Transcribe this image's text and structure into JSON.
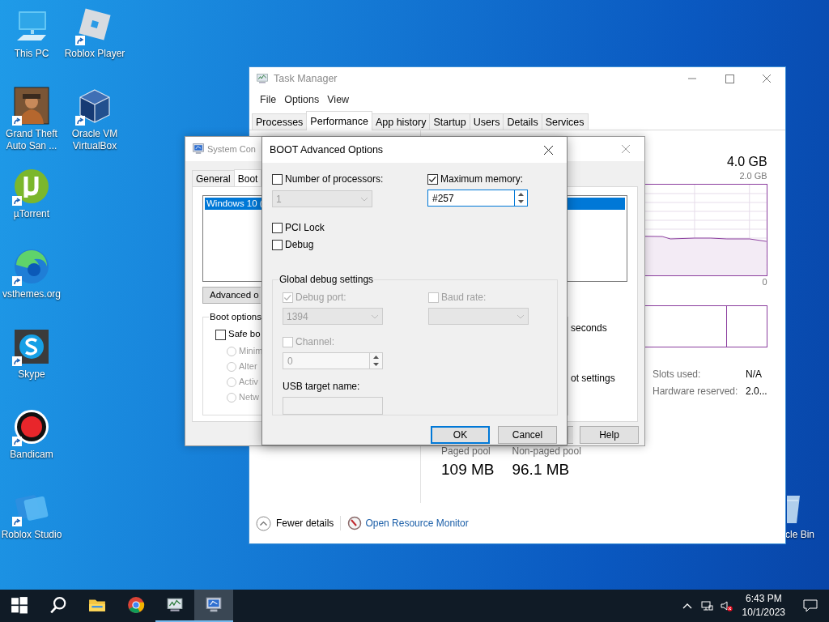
{
  "desktop": {
    "columns": [
      [
        {
          "label": "This PC",
          "kind": "pc",
          "shortcut": false
        },
        {
          "label": "Grand Theft Auto San ...",
          "kind": "game",
          "shortcut": true
        },
        {
          "label": "µTorrent",
          "kind": "torrent",
          "shortcut": true
        },
        {
          "label": "vsthemes.org",
          "kind": "edge",
          "shortcut": true
        },
        {
          "label": "Skype",
          "kind": "skype",
          "shortcut": true
        },
        {
          "label": "Bandicam",
          "kind": "bandicam",
          "shortcut": true
        },
        {
          "label": "Roblox Studio",
          "kind": "studio",
          "shortcut": true
        }
      ],
      [
        {
          "label": "Roblox Player",
          "kind": "roblox",
          "shortcut": true
        },
        {
          "label": "Oracle VM VirtualBox",
          "kind": "virtualbox",
          "shortcut": true
        }
      ]
    ],
    "recycle_bin": {
      "label": "cle Bin"
    }
  },
  "task_manager": {
    "title": "Task Manager",
    "menu": [
      "File",
      "Options",
      "View"
    ],
    "tabs": [
      {
        "label": "Processes",
        "selected": false
      },
      {
        "label": "Performance",
        "selected": true
      },
      {
        "label": "App history",
        "selected": false
      },
      {
        "label": "Startup",
        "selected": false
      },
      {
        "label": "Users",
        "selected": false
      },
      {
        "label": "Details",
        "selected": false
      },
      {
        "label": "Services",
        "selected": false
      }
    ],
    "memory": {
      "total": "4.0 GB",
      "graph_max": "2.0 GB",
      "graph_min": "0"
    },
    "side_stats": [
      {
        "label": "Slots used:",
        "value": "N/A"
      },
      {
        "label": "Hardware reserved:",
        "value": "2.0..."
      }
    ],
    "pools": [
      {
        "label": "Paged pool",
        "value": "109 MB"
      },
      {
        "label": "Non-paged pool",
        "value": "96.1 MB"
      }
    ],
    "footer": {
      "toggle": "Fewer details",
      "link": "Open Resource Monitor"
    }
  },
  "system_config": {
    "title": "System Con",
    "tabs": [
      {
        "label": "General",
        "selected": false
      },
      {
        "label": "Boot",
        "selected": true
      }
    ],
    "boot_entries": [
      {
        "text": "Windows 10 (",
        "selected": true
      }
    ],
    "advanced_button": "Advanced o",
    "boot_options": {
      "label": "Boot options",
      "safe_boot": {
        "label": "Safe bo",
        "checked": false
      },
      "modes": [
        {
          "label": "Minim",
          "selected": false
        },
        {
          "label": "Alter",
          "selected": false
        },
        {
          "label": "Activ",
          "selected": false
        },
        {
          "label": "Netw",
          "selected": false
        }
      ]
    },
    "right_texts": [
      "seconds",
      "ot settings"
    ],
    "partial_button": true,
    "help_button": "Help"
  },
  "boot_advanced": {
    "title": "BOOT Advanced Options",
    "processors": {
      "label": "Number of processors:",
      "checked": false,
      "value": "1",
      "disabled": true
    },
    "memory": {
      "label": "Maximum memory:",
      "checked": true,
      "value": "#257"
    },
    "options": [
      {
        "label": "PCI Lock",
        "checked": false
      },
      {
        "label": "Debug",
        "checked": false
      }
    ],
    "debug": {
      "title": "Global debug settings",
      "disabled": true,
      "port": {
        "label": "Debug port:",
        "checked": true,
        "value": "1394"
      },
      "baud": {
        "label": "Baud rate:",
        "checked": false
      },
      "channel": {
        "label": "Channel:",
        "checked": false,
        "value": "0"
      },
      "usb_label": "USB target name:"
    },
    "buttons": [
      {
        "label": "OK",
        "default": true
      },
      {
        "label": "Cancel",
        "default": false
      }
    ]
  },
  "taskbar": {
    "apps": [
      {
        "kind": "start",
        "running": false,
        "selected": false
      },
      {
        "kind": "search",
        "running": false,
        "selected": false
      },
      {
        "kind": "explorer",
        "running": false,
        "selected": false
      },
      {
        "kind": "chrome",
        "running": false,
        "selected": false
      },
      {
        "kind": "taskmgr",
        "running": true,
        "selected": false
      },
      {
        "kind": "msconfig",
        "running": true,
        "selected": true
      }
    ],
    "clock": {
      "time": "6:43 PM",
      "date": "10/1/2023"
    }
  }
}
